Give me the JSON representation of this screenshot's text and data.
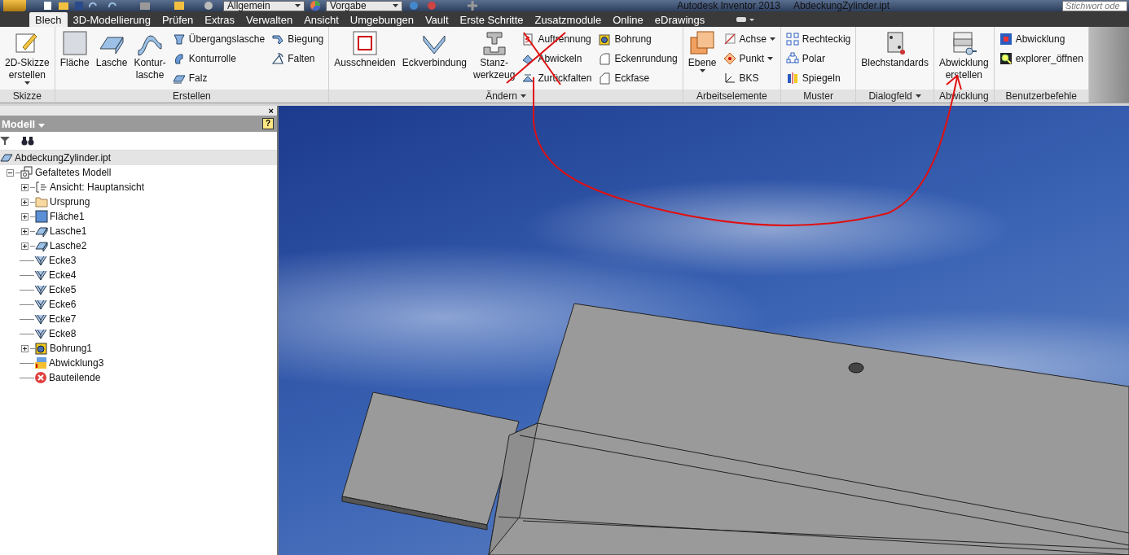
{
  "app_title": "Autodesk Inventor 2013",
  "document_title": "AbdeckungZylinder.ipt",
  "quick_access": {
    "style_combo": "Allgemein",
    "material_combo": "Vorgabe"
  },
  "search": {
    "placeholder": "Stichwort ode"
  },
  "tabs": [
    {
      "label": "Blech",
      "selected": true
    },
    {
      "label": "3D-Modellierung",
      "selected": false
    },
    {
      "label": "Prüfen",
      "selected": false
    },
    {
      "label": "Extras",
      "selected": false
    },
    {
      "label": "Verwalten",
      "selected": false
    },
    {
      "label": "Ansicht",
      "selected": false
    },
    {
      "label": "Umgebungen",
      "selected": false
    },
    {
      "label": "Vault",
      "selected": false
    },
    {
      "label": "Erste Schritte",
      "selected": false
    },
    {
      "label": "Zusatzmodule",
      "selected": false
    },
    {
      "label": "Online",
      "selected": false
    },
    {
      "label": "eDrawings",
      "selected": false
    }
  ],
  "panels": [
    {
      "label": "Skizze",
      "has_menu": false,
      "items": [
        {
          "kind": "large",
          "lines": [
            "2D-Skizze",
            "erstellen"
          ],
          "dropdown": true
        }
      ]
    },
    {
      "label": "Erstellen",
      "has_menu": false,
      "items": [
        {
          "kind": "large",
          "lines": [
            "Fläche"
          ],
          "dropdown": false
        },
        {
          "kind": "large",
          "lines": [
            "Lasche"
          ],
          "dropdown": false
        },
        {
          "kind": "large",
          "lines": [
            "Kontur-",
            "lasche"
          ],
          "dropdown": false
        },
        {
          "kind": "column",
          "buttons": [
            {
              "label": "Übergangslasche",
              "dropdown": false
            },
            {
              "label": "Konturrolle",
              "dropdown": false
            },
            {
              "label": "Falz",
              "dropdown": false
            }
          ]
        },
        {
          "kind": "column",
          "buttons": [
            {
              "label": "Biegung",
              "dropdown": false
            },
            {
              "label": "Falten",
              "dropdown": false
            }
          ]
        }
      ]
    },
    {
      "label": "Ändern",
      "has_menu": true,
      "items": [
        {
          "kind": "large",
          "lines": [
            "Ausschneiden"
          ],
          "dropdown": false
        },
        {
          "kind": "large",
          "lines": [
            "Eckverbindung"
          ],
          "dropdown": false
        },
        {
          "kind": "large",
          "lines": [
            "Stanz-",
            "werkzeug"
          ],
          "dropdown": false
        },
        {
          "kind": "column",
          "buttons": [
            {
              "label": "Auftrennung",
              "dropdown": false
            },
            {
              "label": "Abwickeln",
              "dropdown": false
            },
            {
              "label": "Zurückfalten",
              "dropdown": false
            }
          ]
        },
        {
          "kind": "column",
          "buttons": [
            {
              "label": "Bohrung",
              "dropdown": false
            },
            {
              "label": "Eckenrundung",
              "dropdown": false
            },
            {
              "label": "Eckfase",
              "dropdown": false
            }
          ]
        }
      ]
    },
    {
      "label": "Arbeitselemente",
      "has_menu": false,
      "items": [
        {
          "kind": "large",
          "lines": [
            "Ebene"
          ],
          "dropdown": true
        },
        {
          "kind": "column",
          "buttons": [
            {
              "label": "Achse",
              "dropdown": true
            },
            {
              "label": "Punkt",
              "dropdown": true
            },
            {
              "label": "BKS",
              "dropdown": false
            }
          ]
        }
      ]
    },
    {
      "label": "Muster",
      "has_menu": false,
      "items": [
        {
          "kind": "column",
          "buttons": [
            {
              "label": "Rechteckig",
              "dropdown": false
            },
            {
              "label": "Polar",
              "dropdown": false
            },
            {
              "label": "Spiegeln",
              "dropdown": false
            }
          ]
        }
      ]
    },
    {
      "label": "Dialogfeld",
      "has_menu": true,
      "items": [
        {
          "kind": "large",
          "lines": [
            "Blechstandards"
          ],
          "dropdown": false
        }
      ]
    },
    {
      "label": "Abwicklung",
      "has_menu": false,
      "items": [
        {
          "kind": "large",
          "lines": [
            "Abwicklung",
            "erstellen"
          ],
          "dropdown": false
        }
      ]
    },
    {
      "label": "Benutzerbefehle",
      "has_menu": false,
      "items": [
        {
          "kind": "column",
          "buttons": [
            {
              "label": "Abwicklung",
              "dropdown": false
            },
            {
              "label": "explorer_öffnen",
              "dropdown": false
            }
          ]
        }
      ]
    }
  ],
  "browser": {
    "title": "Modell",
    "close_label": "×",
    "help_label": "?",
    "tree": [
      {
        "label": "AbdeckungZylinder.ipt",
        "kind": "part",
        "selected": true,
        "children": [
          {
            "label": "Gefaltetes Modell",
            "kind": "model",
            "selected": false,
            "has_children": true,
            "expanded": true,
            "children": [
              {
                "label": "Ansicht: Hauptansicht",
                "kind": "view",
                "selected": false,
                "has_children": true,
                "expanded": false
              },
              {
                "label": "Ursprung",
                "kind": "folder",
                "selected": false,
                "has_children": true,
                "expanded": false
              },
              {
                "label": "Fläche1",
                "kind": "face",
                "selected": false,
                "has_children": true,
                "expanded": false
              },
              {
                "label": "Lasche1",
                "kind": "flange",
                "selected": false,
                "has_children": true,
                "expanded": false
              },
              {
                "label": "Lasche2",
                "kind": "flange",
                "selected": false,
                "has_children": true,
                "expanded": false
              },
              {
                "label": "Ecke3",
                "kind": "corner",
                "selected": false,
                "has_children": false
              },
              {
                "label": "Ecke4",
                "kind": "corner",
                "selected": false,
                "has_children": false
              },
              {
                "label": "Ecke5",
                "kind": "corner",
                "selected": false,
                "has_children": false
              },
              {
                "label": "Ecke6",
                "kind": "corner",
                "selected": false,
                "has_children": false
              },
              {
                "label": "Ecke7",
                "kind": "corner",
                "selected": false,
                "has_children": false
              },
              {
                "label": "Ecke8",
                "kind": "corner",
                "selected": false,
                "has_children": false
              },
              {
                "label": "Bohrung1",
                "kind": "hole",
                "selected": false,
                "has_children": true,
                "expanded": false
              },
              {
                "label": "Abwicklung3",
                "kind": "flat-pattern",
                "selected": false,
                "has_children": false
              },
              {
                "label": "Bauteilende",
                "kind": "end",
                "selected": false,
                "has_children": false
              }
            ]
          }
        ]
      }
    ]
  }
}
